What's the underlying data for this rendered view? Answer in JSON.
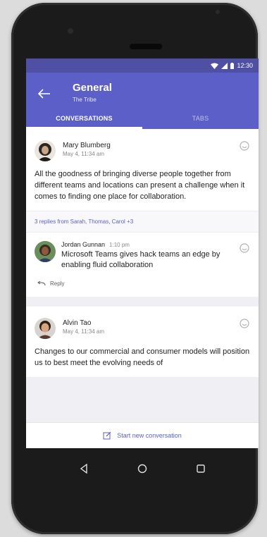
{
  "colors": {
    "accent": "#5b5fc7",
    "status_bar": "#4f4fa3",
    "link": "#5b5fc7"
  },
  "status_bar": {
    "time": "12:30",
    "icons": [
      "wifi-icon",
      "signal-icon",
      "battery-icon"
    ]
  },
  "header": {
    "back_icon": "arrow-left-icon",
    "channel_title": "General",
    "team_name": "The Tribe"
  },
  "tabs": [
    {
      "label": "CONVERSATIONS",
      "active": true
    },
    {
      "label": "TABS",
      "active": false
    }
  ],
  "posts": [
    {
      "author": "Mary Blumberg",
      "time": "May 4, 11:34 am",
      "message": "All the goodness of bringing diverse people together from different teams and locations can present a challenge when it comes to finding one place for collaboration.",
      "replies_summary": "3 replies from Sarah, Thomas, Carol +3",
      "reply": {
        "author": "Jordan Gunnan",
        "time": "1:10 pm",
        "message": "Microsoft Teams gives hack teams an edge by enabling fluid collaboration"
      },
      "reply_action": "Reply"
    },
    {
      "author": "Alvin Tao",
      "time": "May 4, 11:34 am",
      "message": "Changes to our commercial and consumer models will position us to best meet the evolving needs of"
    }
  ],
  "compose": {
    "label": "Start new conversation",
    "icon": "compose-icon"
  },
  "navigation": [
    "back-triangle-icon",
    "home-circle-icon",
    "recents-square-icon"
  ]
}
